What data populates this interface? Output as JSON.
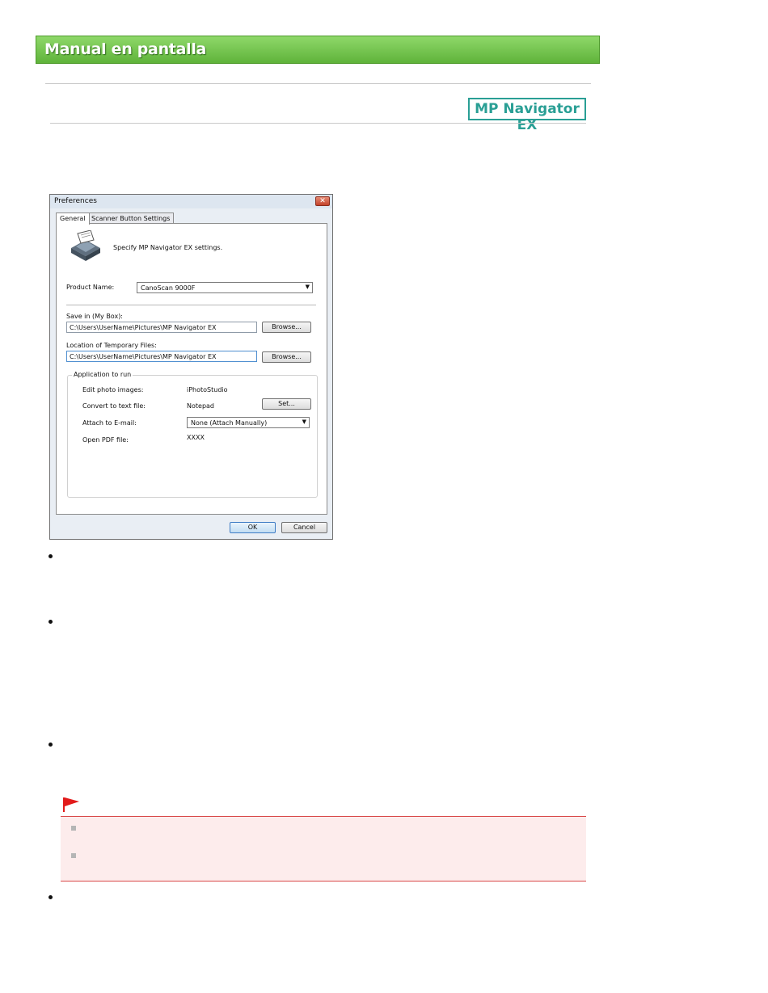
{
  "header": {
    "banner_title": "Manual en pantalla",
    "badge": "MP Navigator EX"
  },
  "dialog": {
    "title": "Preferences",
    "close_glyph": "✕",
    "tabs": [
      {
        "label": "General",
        "active": true
      },
      {
        "label": "Scanner Button Settings",
        "active": false
      }
    ],
    "intro_text": "Specify MP Navigator EX settings.",
    "product_name": {
      "label": "Product Name:",
      "value": "CanoScan 9000F"
    },
    "save_in": {
      "label": "Save in (My Box):",
      "value": "C:\\Users\\UserName\\Pictures\\MP Navigator EX",
      "browse_label": "Browse..."
    },
    "temp_location": {
      "label": "Location of Temporary Files:",
      "value": "C:\\Users\\UserName\\Pictures\\MP Navigator EX",
      "browse_label": "Browse..."
    },
    "app_group": {
      "label": "Application to run",
      "edit_photo": {
        "label": "Edit photo images:",
        "value": "iPhotoStudio"
      },
      "convert_text": {
        "label": "Convert to text file:",
        "value": "Notepad",
        "set_label": "Set..."
      },
      "attach_email": {
        "label": "Attach to E-mail:",
        "value": "None (Attach Manually)"
      },
      "open_pdf": {
        "label": "Open PDF file:",
        "value": "XXXX"
      }
    },
    "ok_label": "OK",
    "cancel_label": "Cancel"
  },
  "icons": {
    "scanner": "scanner-icon",
    "flag": "important-flag-icon",
    "dropdown": "chevron-down-icon"
  },
  "colors": {
    "banner": "#6cc24a",
    "badge": "#2a9f95",
    "note_bg": "#fdecec",
    "note_border": "#d94a4a",
    "flag": "#e21b1b"
  }
}
